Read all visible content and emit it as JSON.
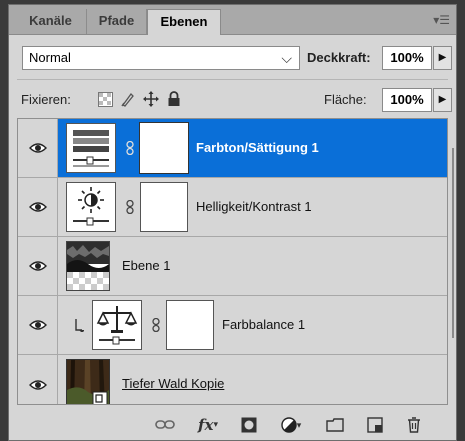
{
  "tabs": [
    {
      "label": "Kanäle",
      "active": false
    },
    {
      "label": "Pfade",
      "active": false
    },
    {
      "label": "Ebenen",
      "active": true
    }
  ],
  "blend_mode": {
    "value": "Normal"
  },
  "opacity": {
    "label": "Deckkraft:",
    "value": "100%"
  },
  "lock": {
    "label": "Fixieren:"
  },
  "fill": {
    "label": "Fläche:",
    "value": "100%"
  },
  "layers": [
    {
      "name": "Farbton/Sättigung 1",
      "selected": true,
      "type": "adjustment-hue-saturation"
    },
    {
      "name": "Helligkeit/Kontrast 1",
      "selected": false,
      "type": "adjustment-brightness-contrast"
    },
    {
      "name": "Ebene 1",
      "selected": false,
      "type": "pixel"
    },
    {
      "name": "Farbbalance 1",
      "selected": false,
      "type": "adjustment-color-balance",
      "clipped": true
    },
    {
      "name": "Tiefer Wald Kopie",
      "selected": false,
      "type": "smart-object"
    }
  ],
  "colors": {
    "selection": "#0a6fd8",
    "panel": "#d6d6d6"
  },
  "bottom_icons": [
    "link-icon",
    "fx-icon",
    "mask-icon",
    "adjustment-icon",
    "folder-icon",
    "new-layer-icon",
    "trash-icon"
  ],
  "fx_label": "fx"
}
